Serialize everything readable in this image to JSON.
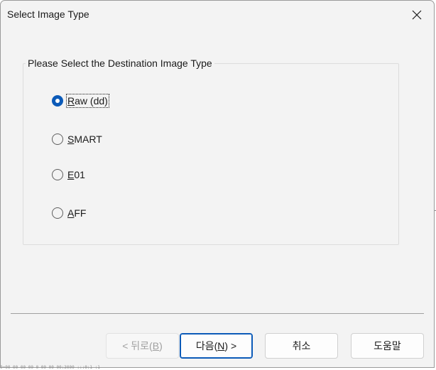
{
  "window": {
    "title": "Select Image Type",
    "close_icon": "close-icon"
  },
  "group": {
    "legend": "Please Select the Destination Image Type"
  },
  "options": [
    {
      "mnemonic": "R",
      "rest": "aw (dd)",
      "checked": true
    },
    {
      "mnemonic": "S",
      "rest": "MART",
      "checked": false
    },
    {
      "mnemonic": "E",
      "rest": "01",
      "checked": false
    },
    {
      "mnemonic": "A",
      "rest": "FF",
      "checked": false
    }
  ],
  "buttons": {
    "back": {
      "prefix": "< 뒤로(",
      "mnemonic": "B",
      "suffix": ")",
      "enabled": false
    },
    "next": {
      "prefix": "다음(",
      "mnemonic": "N",
      "suffix": ") >",
      "enabled": true
    },
    "cancel": {
      "label": "취소"
    },
    "help": {
      "label": "도움말"
    }
  },
  "colors": {
    "accent": "#0b5ab8",
    "dialog_bg": "#f3f3f3"
  },
  "status_text": "0=00 00 00 00 0 00 00 00:3000 :::0:1 :1"
}
